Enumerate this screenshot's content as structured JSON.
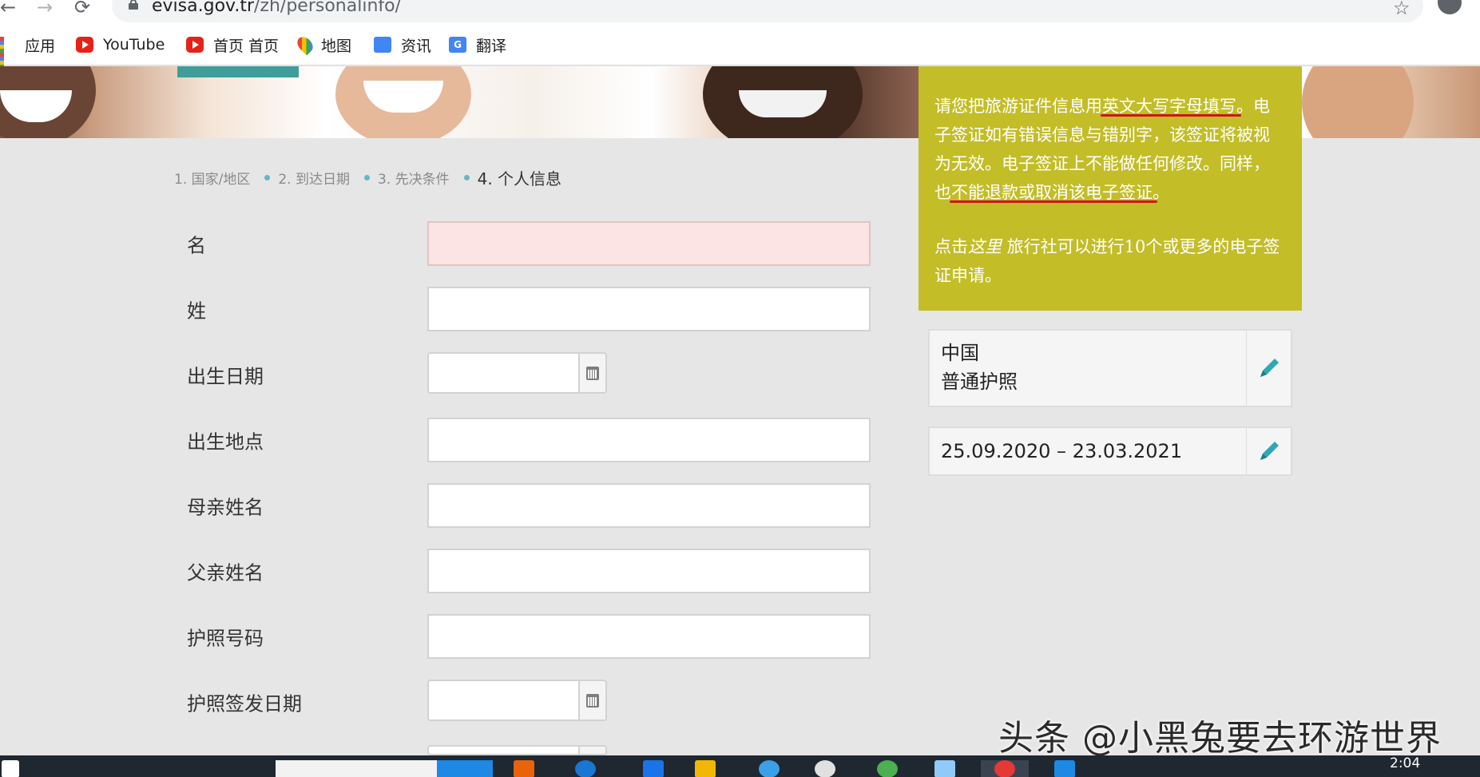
{
  "browser": {
    "url_host": "evisa.gov.tr",
    "url_path": "/zh/personalinfo/",
    "bookmarks": [
      {
        "label": "应用",
        "icon": "apps-icon"
      },
      {
        "label": "YouTube",
        "icon": "youtube-icon"
      },
      {
        "label": "首页 首页",
        "icon": "youtube-icon"
      },
      {
        "label": "地图",
        "icon": "maps-icon"
      },
      {
        "label": "资讯",
        "icon": "news-icon"
      },
      {
        "label": "翻译",
        "icon": "translate-icon"
      }
    ]
  },
  "steps": [
    {
      "label": "1. 国家/地区"
    },
    {
      "label": "2. 到达日期"
    },
    {
      "label": "3. 先决条件"
    },
    {
      "label": "4. 个人信息"
    }
  ],
  "form": {
    "fields": [
      {
        "label": "名",
        "value": ""
      },
      {
        "label": "姓",
        "value": ""
      },
      {
        "label": "出生日期",
        "value": ""
      },
      {
        "label": "出生地点",
        "value": ""
      },
      {
        "label": "母亲姓名",
        "value": ""
      },
      {
        "label": "父亲姓名",
        "value": ""
      },
      {
        "label": "护照号码",
        "value": ""
      },
      {
        "label": "护照签发日期",
        "value": ""
      }
    ]
  },
  "notice": {
    "p1_a": "请您把旅游证件信息用",
    "p1_u1": "英文大写字母填写",
    "p1_b": "。电子签证如有错误信息与错别字，该签证将被视为无效。电子签证上不能做任何修改。同样，也",
    "p1_u2": "不能退款或取消该电子签证",
    "p1_c": "。",
    "p2_a": "点击",
    "p2_link": "这里",
    "p2_b": " 旅行社可以进行10个或更多的电子签证申请。"
  },
  "summary": {
    "country": "中国",
    "passport_type": "普通护照",
    "date_range": "25.09.2020 – 23.03.2021"
  },
  "watermark": "头条 @小黑兔要去环游世界",
  "taskbar": {
    "clock": "2:04"
  },
  "colors": {
    "notice_bg": "#c3bd28",
    "accent_teal": "#3f9e9a",
    "error_field": "#fde4e4",
    "underline_red": "#d01414"
  }
}
